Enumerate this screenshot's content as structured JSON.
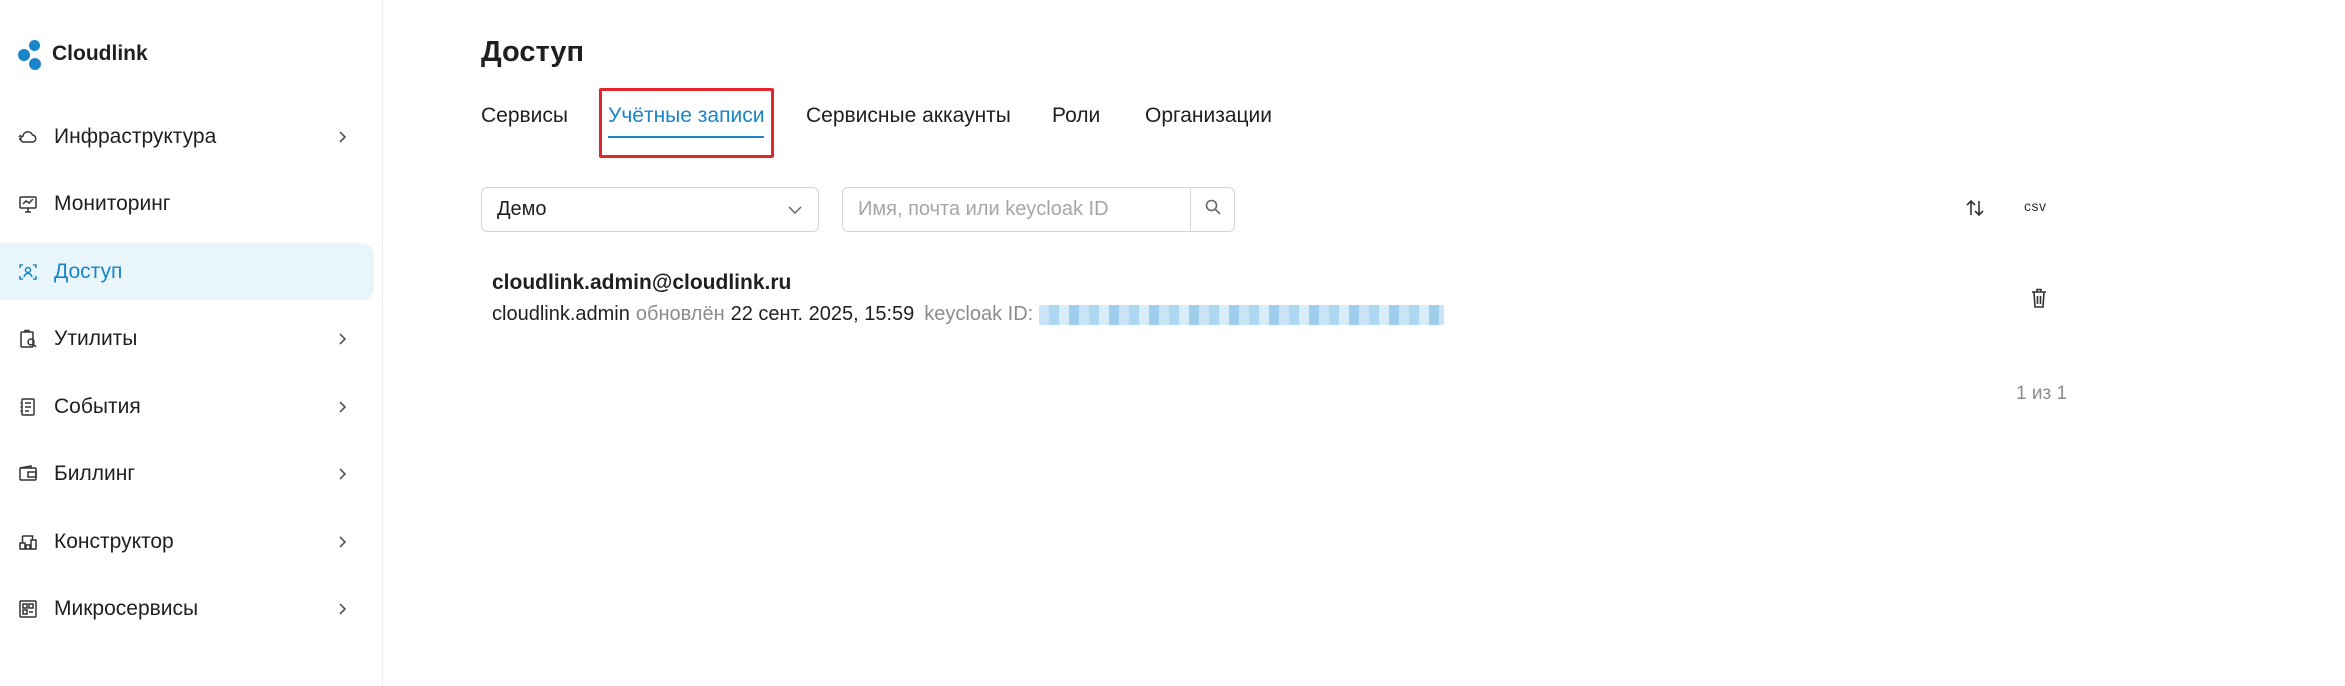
{
  "brand": {
    "name": "Cloudlink",
    "color": "#1a85c9"
  },
  "sidebar": {
    "items": [
      {
        "label": "Инфраструктура",
        "icon": "cloud-icon",
        "has_chevron": true,
        "active": false
      },
      {
        "label": "Мониторинг",
        "icon": "monitor-icon",
        "has_chevron": false,
        "active": false
      },
      {
        "label": "Доступ",
        "icon": "access-icon",
        "has_chevron": false,
        "active": true
      },
      {
        "label": "Утилиты",
        "icon": "utilities-icon",
        "has_chevron": true,
        "active": false
      },
      {
        "label": "События",
        "icon": "events-icon",
        "has_chevron": true,
        "active": false
      },
      {
        "label": "Биллинг",
        "icon": "wallet-icon",
        "has_chevron": true,
        "active": false
      },
      {
        "label": "Конструктор",
        "icon": "constructor-icon",
        "has_chevron": true,
        "active": false
      },
      {
        "label": "Микросервисы",
        "icon": "microservices-icon",
        "has_chevron": true,
        "active": false
      }
    ]
  },
  "page": {
    "title": "Доступ",
    "tabs": [
      {
        "label": "Сервисы",
        "active": false
      },
      {
        "label": "Учётные записи",
        "active": true
      },
      {
        "label": "Сервисные аккаунты",
        "active": false
      },
      {
        "label": "Роли",
        "active": false
      },
      {
        "label": "Организации",
        "active": false
      }
    ],
    "highlight_color": "#e1262c"
  },
  "filters": {
    "select_value": "Демо",
    "search_placeholder": "Имя, почта или keycloak ID",
    "csv_label": "csv"
  },
  "record": {
    "email": "cloudlink.admin@cloudlink.ru",
    "login": "cloudlink.admin",
    "updated_label": "обновлён",
    "updated_date": "22 сент. 2025, 15:59",
    "keycloak_label": "keycloak ID:"
  },
  "pagination": {
    "text": "1 из 1"
  }
}
